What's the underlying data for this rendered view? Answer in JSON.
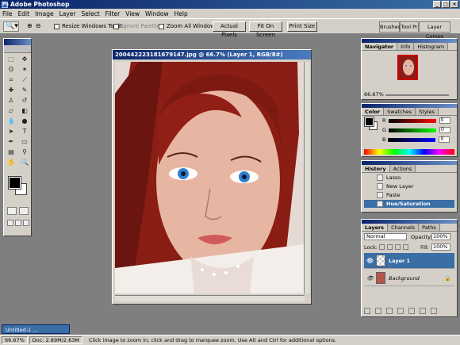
{
  "app": {
    "title": "Adobe Photoshop"
  },
  "menu": [
    "File",
    "Edit",
    "Image",
    "Layer",
    "Select",
    "Filter",
    "View",
    "Window",
    "Help"
  ],
  "options_bar": {
    "resize_windows": "Resize Windows To Fit",
    "ignore_palettes": "Ignore Palettes",
    "zoom_all": "Zoom All Windows",
    "actual_pixels": "Actual Pixels",
    "fit_on_screen": "Fit On Screen",
    "print_size": "Print Size",
    "well_tabs": [
      "Brushes",
      "Tool Pr",
      "Layer Comps"
    ]
  },
  "document": {
    "title": "200442223181679147.jpg @ 66.7% (Layer 1, RGB/8#)"
  },
  "navigator": {
    "tabs": [
      "Navigator",
      "Info",
      "Histogram"
    ],
    "zoom": "66.67%"
  },
  "color": {
    "tabs": [
      "Color",
      "Swatches",
      "Styles"
    ],
    "channels": [
      {
        "label": "R",
        "value": "0"
      },
      {
        "label": "G",
        "value": "0"
      },
      {
        "label": "B",
        "value": "0"
      }
    ]
  },
  "history": {
    "tabs": [
      "History",
      "Actions"
    ],
    "items": [
      "Lasso",
      "New Layer",
      "Paste",
      "Hue/Saturation"
    ]
  },
  "layers": {
    "tabs": [
      "Layers",
      "Channels",
      "Paths"
    ],
    "blend_mode": "Normal",
    "opacity_label": "Opacity:",
    "opacity": "100%",
    "lock_label": "Lock:",
    "fill_label": "Fill:",
    "fill": "100%",
    "items": [
      "Layer 1",
      "Background"
    ]
  },
  "taskbar": {
    "doc_button": "Untitled-1 ..."
  },
  "status": {
    "zoom": "66.67%",
    "doc": "Doc: 2.89M/2.63M",
    "hint": "Click image to zoom in; click and drag to marquee zoom.  Use Alt and Ctrl for additional options."
  },
  "colors": {
    "title_blue": "#0a246a",
    "select_blue": "#3a6ea5",
    "chrome": "#d4d0c8",
    "workspace": "#7f7f7f"
  }
}
